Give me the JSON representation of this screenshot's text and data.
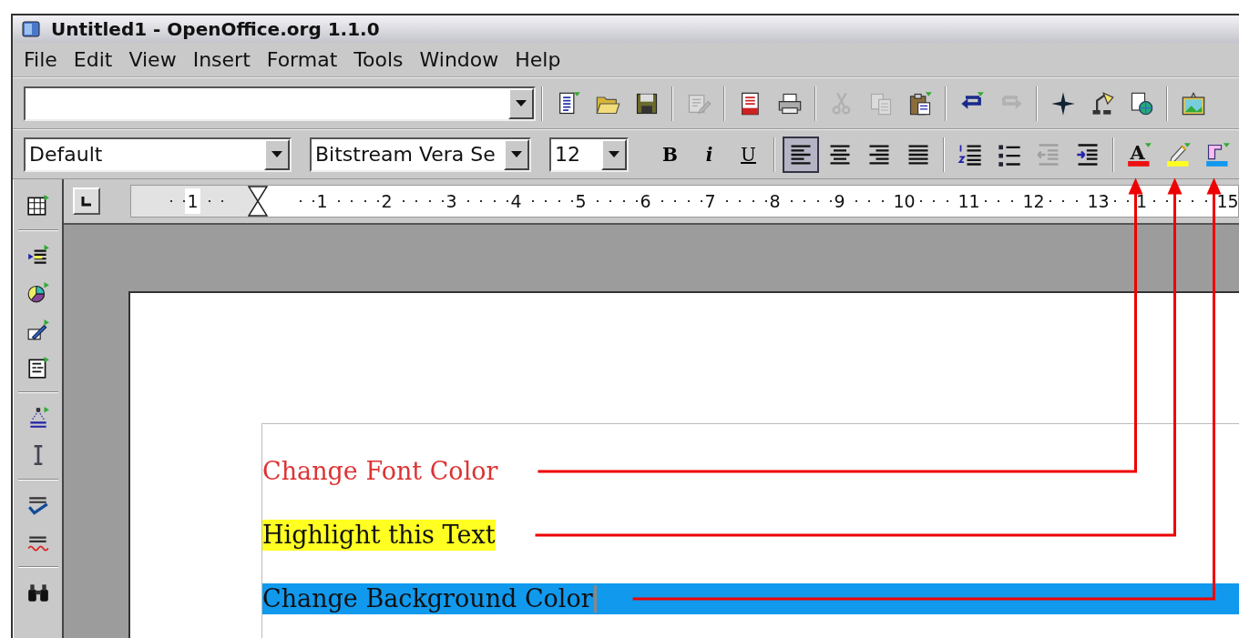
{
  "window": {
    "title": "Untitled1 - OpenOffice.org 1.1.0"
  },
  "menu": [
    {
      "label": "File"
    },
    {
      "label": "Edit"
    },
    {
      "label": "View"
    },
    {
      "label": "Insert"
    },
    {
      "label": "Format"
    },
    {
      "label": "Tools"
    },
    {
      "label": "Window"
    },
    {
      "label": "Help"
    }
  ],
  "function_bar": {
    "items": [
      {
        "kind": "new",
        "disabled": false
      },
      {
        "kind": "open",
        "disabled": false
      },
      {
        "kind": "save",
        "disabled": false
      },
      {
        "kind": "separator"
      },
      {
        "kind": "edit-file",
        "disabled": true
      },
      {
        "kind": "separator"
      },
      {
        "kind": "pdf",
        "disabled": false
      },
      {
        "kind": "print",
        "disabled": false
      },
      {
        "kind": "separator"
      },
      {
        "kind": "cut",
        "disabled": true
      },
      {
        "kind": "copy",
        "disabled": true
      },
      {
        "kind": "paste",
        "disabled": false
      },
      {
        "kind": "separator"
      },
      {
        "kind": "undo",
        "disabled": false
      },
      {
        "kind": "redo",
        "disabled": true
      },
      {
        "kind": "separator"
      },
      {
        "kind": "navigator",
        "disabled": false
      },
      {
        "kind": "lamp",
        "disabled": false
      },
      {
        "kind": "globe-doc",
        "disabled": false
      },
      {
        "kind": "separator"
      },
      {
        "kind": "gallery",
        "disabled": false
      }
    ]
  },
  "object_bar": {
    "paragraph_style": "Default",
    "font_name": "Bitstream Vera Se",
    "font_size": "12",
    "items": [
      {
        "kind": "bold",
        "label": "B",
        "selected": false,
        "disabled": false
      },
      {
        "kind": "italic",
        "label": "i",
        "selected": false,
        "disabled": false
      },
      {
        "kind": "underline",
        "label": "U",
        "selected": false,
        "disabled": false
      },
      {
        "kind": "separator"
      },
      {
        "kind": "align-left",
        "selected": true,
        "disabled": false
      },
      {
        "kind": "align-center",
        "selected": false,
        "disabled": false
      },
      {
        "kind": "align-right",
        "selected": false,
        "disabled": false
      },
      {
        "kind": "justify",
        "selected": false,
        "disabled": false
      },
      {
        "kind": "separator"
      },
      {
        "kind": "numbering",
        "selected": false,
        "disabled": false
      },
      {
        "kind": "bullets",
        "selected": false,
        "disabled": false
      },
      {
        "kind": "outdent",
        "selected": false,
        "disabled": true
      },
      {
        "kind": "indent",
        "selected": false,
        "disabled": false
      },
      {
        "kind": "separator"
      },
      {
        "kind": "font-color",
        "label": "A",
        "color": "#ee1111",
        "selected": false,
        "disabled": false
      },
      {
        "kind": "highlight",
        "color": "#ffff22",
        "selected": false,
        "disabled": false
      },
      {
        "kind": "background",
        "color": "#1199ee",
        "selected": false,
        "disabled": false
      }
    ]
  },
  "main_toolbar": {
    "items": [
      {
        "kind": "table"
      },
      {
        "kind": "separator"
      },
      {
        "kind": "fields"
      },
      {
        "kind": "chart"
      },
      {
        "kind": "draw"
      },
      {
        "kind": "form"
      },
      {
        "kind": "separator"
      },
      {
        "kind": "autotext"
      },
      {
        "kind": "text-cursor"
      },
      {
        "kind": "separator"
      },
      {
        "kind": "spellcheck"
      },
      {
        "kind": "autospell"
      },
      {
        "kind": "separator"
      },
      {
        "kind": "find"
      }
    ]
  },
  "ruler": {
    "marks": [
      {
        "kind": "number",
        "label": "1"
      },
      {
        "kind": "indent-marker"
      },
      {
        "kind": "number",
        "label": "1"
      },
      {
        "kind": "number",
        "label": "2"
      },
      {
        "kind": "number",
        "label": "3"
      },
      {
        "kind": "number",
        "label": "4"
      },
      {
        "kind": "number",
        "label": "5"
      },
      {
        "kind": "number",
        "label": "6"
      },
      {
        "kind": "number",
        "label": "7"
      },
      {
        "kind": "number",
        "label": "8"
      },
      {
        "kind": "number",
        "label": "9"
      },
      {
        "kind": "number",
        "label": "10"
      },
      {
        "kind": "number",
        "label": "11"
      },
      {
        "kind": "number",
        "label": "12"
      },
      {
        "kind": "number",
        "label": "13"
      },
      {
        "kind": "number",
        "label": "1"
      },
      {
        "kind": "number",
        "label": "15"
      }
    ]
  },
  "document": {
    "lines": [
      {
        "kind": "font-color",
        "text": "Change Font Color",
        "color": "#dd3333",
        "cursor": false
      },
      {
        "kind": "highlight",
        "text": "Highlight this Text",
        "color": "#ffff22",
        "cursor": false
      },
      {
        "kind": "background",
        "text": "Change Background Color",
        "color": "#1199ee",
        "cursor": true
      }
    ]
  }
}
